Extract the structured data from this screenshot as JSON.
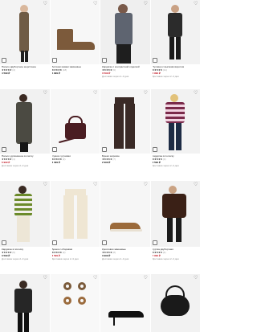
{
  "products": [
    {
      "name": "Пальто двубортное шерстяное",
      "rating": "(4)",
      "price": "4 599 ₽",
      "note": "",
      "stars": "★★★★★"
    },
    {
      "name": "Ботинки казаки замшевые",
      "rating": "(18)",
      "price": "4 999 ₽",
      "note": "",
      "stars": "★★★★★"
    },
    {
      "name": "Кардиган с контрастной отделкой",
      "rating": "(6)",
      "price": "3 599 ₽",
      "note": "Доставка через 2–3 дня",
      "stars": "★★★★★"
    },
    {
      "name": "Пуловер с высоким воротом",
      "rating": "(11)",
      "price": "2 999 ₽",
      "note": "Доставка через 2–3 дня",
      "stars": "★★★★★"
    },
    {
      "name": "Пальто удлинённое в клетку",
      "rating": "(1)",
      "price": "6 999 ₽",
      "note": "Доставка через 2–3 дня",
      "stars": "★★★★★"
    },
    {
      "name": "Сумка с ручками",
      "rating": "(2)",
      "price": "3 399 ₽",
      "note": "",
      "stars": "★★★★★"
    },
    {
      "name": "Брюки широкие",
      "rating": "(7)",
      "price": "2 999 ₽",
      "note": "",
      "stars": "★★★★★"
    },
    {
      "name": "Кардиган в полоску",
      "rating": "(3)",
      "price": "3 599 ₽",
      "note": "Доставка через 2–3 дня",
      "stars": "★★★★★"
    },
    {
      "name": "Кардиган в полоску",
      "rating": "(5)",
      "price": "3 599 ₽",
      "note": "Доставка через 2–3 дня",
      "stars": "★★★★★"
    },
    {
      "name": "Брюки с оборками",
      "rating": "(2)",
      "price": "3 599 ₽",
      "note": "Доставка через 2–3 дня",
      "stars": "★★★★★"
    },
    {
      "name": "Кроссовки замшевые",
      "rating": "(8)",
      "price": "3 999 ₽",
      "note": "Доставка через 2–3 дня",
      "stars": "★★★★★"
    },
    {
      "name": "Куртка двубортная",
      "rating": "(4)",
      "price": "7 999 ₽",
      "note": "Доставка через 2–3 дня",
      "stars": "★★★★★"
    },
    {
      "name": "",
      "rating": "",
      "price": "",
      "note": "",
      "stars": ""
    },
    {
      "name": "",
      "rating": "",
      "price": "",
      "note": "",
      "stars": ""
    },
    {
      "name": "",
      "rating": "",
      "price": "",
      "note": "",
      "stars": ""
    },
    {
      "name": "",
      "rating": "",
      "price": "",
      "note": "",
      "stars": ""
    }
  ],
  "icons": {
    "favorite": "heart-icon",
    "add_to_bag": "bag-icon"
  },
  "colors": {
    "price": "#111111",
    "muted": "#8a8a8a",
    "background": "#ffffff"
  }
}
